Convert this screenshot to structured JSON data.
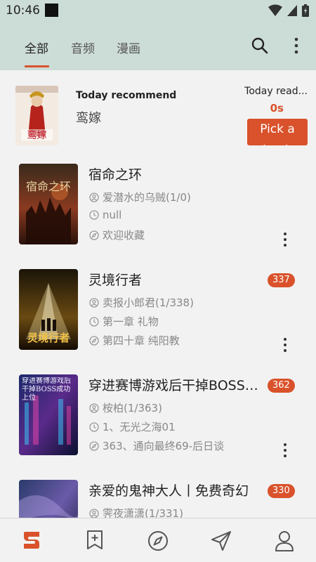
{
  "status_bar": {
    "time": "10:46"
  },
  "tabs": [
    {
      "label": "全部",
      "active": true
    },
    {
      "label": "音频",
      "active": false
    },
    {
      "label": "漫画",
      "active": false
    }
  ],
  "recommend": {
    "heading": "Today recommend",
    "title": "鸾嫁",
    "cover_text": "鸾嫁",
    "read_label": "Today read...",
    "read_time": "0s",
    "button_label": "Pick a book"
  },
  "books": [
    {
      "title": "宿命之环",
      "author": "爱潜水的乌贼(1/0)",
      "last_read": "null",
      "latest": "欢迎收藏",
      "badge": "",
      "cover_text": "宿命之环"
    },
    {
      "title": "灵境行者",
      "author": "卖报小郎君(1/338)",
      "last_read": "第一章 礼物",
      "latest": "第四十章 纯阳教",
      "badge": "337",
      "cover_text": "灵境行者"
    },
    {
      "title": "穿进赛博游戏后干掉BOSS成功上位",
      "author": "桉柏(1/363)",
      "last_read": "1、无光之海01",
      "latest": "363、通向最终69-后日谈",
      "badge": "362",
      "cover_text": "穿进赛博游戏后干掉BOSS成功上位"
    },
    {
      "title": "亲爱的鬼神大人丨免费奇幻",
      "author": "霁夜潇潇(1/331)",
      "last_read": "",
      "latest": "",
      "badge": "330",
      "cover_text": ""
    }
  ],
  "colors": {
    "accent": "#d9522b",
    "topbar_bg": "#ccdcd6",
    "page_bg": "#f2f2f2"
  },
  "bottom_nav": [
    {
      "icon": "bookshelf-logo-icon",
      "active": true
    },
    {
      "icon": "bookmark-add-icon"
    },
    {
      "icon": "compass-icon"
    },
    {
      "icon": "send-icon"
    },
    {
      "icon": "person-icon"
    }
  ]
}
